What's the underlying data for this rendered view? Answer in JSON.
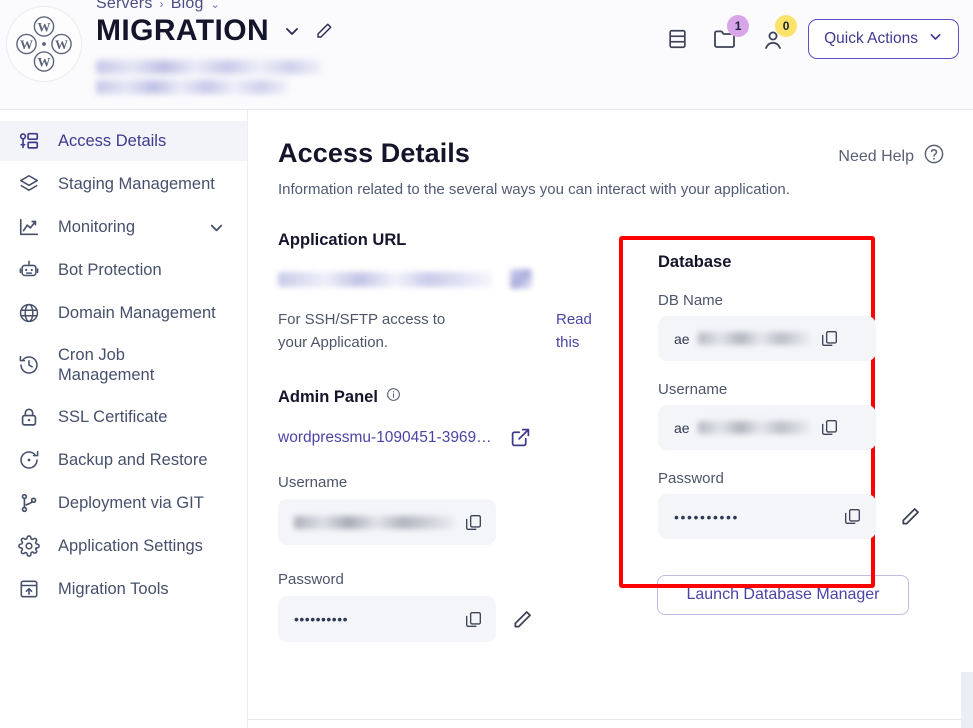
{
  "header": {
    "breadcrumb": {
      "root": "Servers",
      "separator": "›",
      "current": "Blog",
      "caret": "⌄"
    },
    "app_title": "MIGRATION",
    "logo_name": "wordpress-multisite-logo",
    "blurred_urls": [
      "redacted-application-url-line-1",
      "redacted-application-url-line-2"
    ],
    "actions": {
      "server_icon": "database-stack-icon",
      "folder_icon": "folder-icon",
      "folder_badge": "1",
      "user_icon": "user-icon",
      "user_badge": "0",
      "quick_actions_label": "Quick Actions"
    }
  },
  "sidebar": {
    "items": [
      {
        "label": "Access Details",
        "icon": "key-list-icon",
        "active": true,
        "caret": false
      },
      {
        "label": "Staging Management",
        "icon": "layers-icon",
        "active": false,
        "caret": false
      },
      {
        "label": "Monitoring",
        "icon": "line-chart-icon",
        "active": false,
        "caret": true
      },
      {
        "label": "Bot Protection",
        "icon": "robot-icon",
        "active": false,
        "caret": false
      },
      {
        "label": "Domain Management",
        "icon": "www-globe-icon",
        "active": false,
        "caret": false
      },
      {
        "label": "Cron Job Management",
        "icon": "clock-history-icon",
        "active": false,
        "caret": false
      },
      {
        "label": "SSL Certificate",
        "icon": "lock-icon",
        "active": false,
        "caret": false
      },
      {
        "label": "Backup and Restore",
        "icon": "restore-icon",
        "active": false,
        "caret": false
      },
      {
        "label": "Deployment via GIT",
        "icon": "git-branch-icon",
        "active": false,
        "caret": false
      },
      {
        "label": "Application Settings",
        "icon": "gear-icon",
        "active": false,
        "caret": false
      },
      {
        "label": "Migration Tools",
        "icon": "upload-box-icon",
        "active": false,
        "caret": false
      }
    ]
  },
  "main": {
    "title": "Access Details",
    "subtitle": "Information related to the several ways you can interact with your application.",
    "need_help_label": "Need Help",
    "need_help_icon": "question-circle-icon",
    "application_url": {
      "section_title": "Application URL",
      "url_value": "[blurred]",
      "external_icon": "external-link-icon",
      "ssh_text": "For SSH/SFTP access to your Application.",
      "read_link": "Read this"
    },
    "admin_panel": {
      "section_title": "Admin Panel",
      "info_icon": "info-circle-icon",
      "link": "wordpressmu-1090451-3969…",
      "external_icon": "external-link-icon",
      "username_label": "Username",
      "username_value": "[blurred]",
      "password_label": "Password",
      "password_value": "••••••••••",
      "copy_icon": "copy-icon",
      "edit_icon": "edit-pencil-icon"
    },
    "database": {
      "section_title": "Database",
      "highlight_color": "#ff0000",
      "db_name_label": "DB Name",
      "db_name_prefix": "ae",
      "db_name_value": "ae[blurred]",
      "username_label": "Username",
      "username_prefix": "ae",
      "username_value": "ae[blurred]",
      "password_label": "Password",
      "password_value": "••••••••••",
      "copy_icon": "copy-icon",
      "edit_icon": "edit-pencil-icon",
      "launch_button": "Launch Database Manager"
    }
  },
  "theme": {
    "accent": "#4a44a8",
    "accent_border": "#5c50c9",
    "highlight": "#ff0000",
    "badge_purple": "#d8a6e8",
    "badge_yellow": "#fbe36b",
    "field_bg": "#f4f5f9"
  }
}
